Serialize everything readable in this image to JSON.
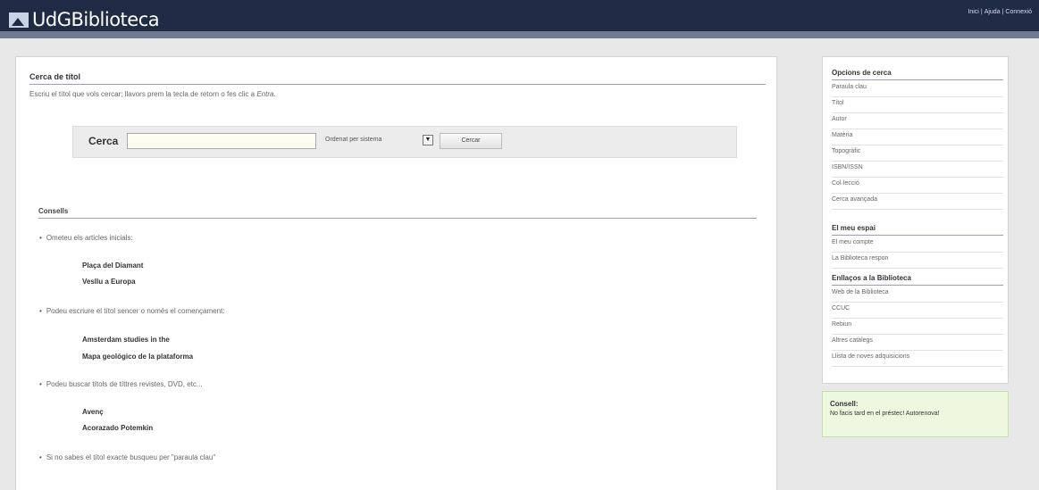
{
  "header": {
    "logo_text": "UdGBiblioteca",
    "links": [
      "Inici",
      "Ajuda",
      "Connexió"
    ]
  },
  "main": {
    "title": "Cerca de títol",
    "description_prefix": "Escriu el títol que vols cercar; llavors prem la tecla de retorn o fes clic a ",
    "description_em": "Entra",
    "description_suffix": ".",
    "search": {
      "label": "Cerca",
      "value": "",
      "placeholder": "",
      "sort_selected": "Ordenat per sistema",
      "button_label": "Cercar"
    },
    "tips_title": "Consells",
    "tips": [
      {
        "text": "Ometeu els articles inicials:",
        "examples": [
          "Plaça del Diamant",
          "Vesllu a Europa"
        ]
      },
      {
        "text": "Podeu escriure el títol sencer o només el començament:",
        "examples": [
          "Amsterdam studies in the",
          "Mapa geológico de la plataforma"
        ]
      },
      {
        "text": "Podeu buscar títols de títtres revistes, DVD, etc...",
        "examples": [
          "Avenç",
          "Acorazado Potemkin"
        ]
      },
      {
        "text": "Si no sabes el títol exacte busqueu per \"paraula clau\"",
        "examples": []
      }
    ]
  },
  "sidebar": {
    "search_options_title": "Opcions de cerca",
    "search_options": [
      "Paraula clau",
      "Títol",
      "Autor",
      "Matèria",
      "Topogràfic",
      "ISBN/ISSN",
      "Col·lecció",
      "Cerca avançada"
    ],
    "my_space_title": "El meu espai",
    "my_space": [
      "El meu compte",
      "La Biblioteca respon"
    ],
    "links_title": "Enllaços a la Biblioteca",
    "links": [
      "Web de la Biblioteca",
      "CCUC",
      "Rebiun",
      "Altres catàlegs",
      "Llista de noves adquisicions"
    ]
  },
  "advice": {
    "title": "Consell:",
    "text": "No facis tard en el préstec! Autorenova!"
  },
  "colors": {
    "header_bg": "#1f2b45",
    "header_stripe": "#6f7b93",
    "advice_bg": "#edf8df"
  }
}
